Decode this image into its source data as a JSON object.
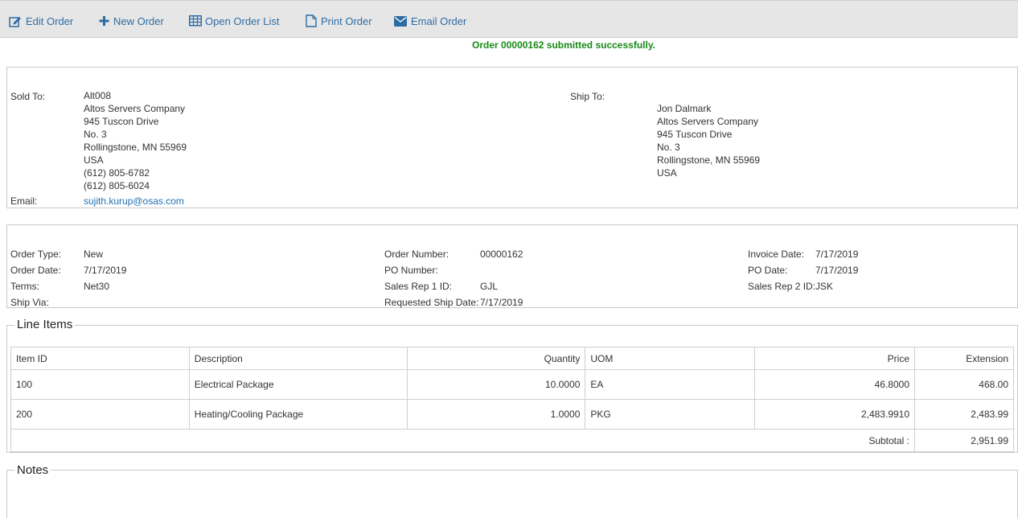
{
  "toolbar": {
    "items": [
      {
        "label": "Edit Order",
        "icon": "edit-icon"
      },
      {
        "label": "New Order",
        "icon": "plus-icon"
      },
      {
        "label": "Open Order List",
        "icon": "table-icon"
      },
      {
        "label": "Print Order",
        "icon": "document-icon"
      },
      {
        "label": "Email Order",
        "icon": "envelope-icon"
      }
    ]
  },
  "message": "Order 00000162 submitted successfully.",
  "sold_to": {
    "label": "Sold To:",
    "lines": [
      "Alt008",
      "Altos Servers Company",
      "945 Tuscon Drive",
      "No. 3",
      "Rollingstone, MN 55969",
      "USA",
      "(612) 805-6782",
      "(612) 805-6024"
    ],
    "email_label": "Email:",
    "email": "sujith.kurup@osas.com"
  },
  "ship_to": {
    "label": "Ship To:",
    "lines": [
      "Jon Dalmark",
      "Altos Servers Company",
      "945 Tuscon Drive",
      "No. 3",
      "Rollingstone, MN 55969",
      "USA"
    ]
  },
  "order_info": {
    "col1": [
      {
        "label": "Order Type:",
        "value": "New"
      },
      {
        "label": "Order Date:",
        "value": "7/17/2019"
      },
      {
        "label": "Terms:",
        "value": "Net30"
      },
      {
        "label": "Ship Via:",
        "value": ""
      }
    ],
    "col2": [
      {
        "label": "Order Number:",
        "value": "00000162"
      },
      {
        "label": "PO Number:",
        "value": ""
      },
      {
        "label": "Sales Rep 1 ID:",
        "value": "GJL"
      },
      {
        "label": "Requested Ship Date:",
        "value": "7/17/2019"
      }
    ],
    "col3": [
      {
        "label": "Invoice Date:",
        "value": "7/17/2019"
      },
      {
        "label": "PO Date:",
        "value": "7/17/2019"
      },
      {
        "label": "Sales Rep 2 ID:",
        "value": "JSK"
      }
    ]
  },
  "line_items": {
    "title": "Line Items",
    "headers": [
      "Item ID",
      "Description",
      "Quantity",
      "UOM",
      "Price",
      "Extension"
    ],
    "rows": [
      [
        "100",
        "Electrical Package",
        "10.0000",
        "EA",
        "46.8000",
        "468.00"
      ],
      [
        "200",
        "Heating/Cooling Package",
        "1.0000",
        "PKG",
        "2,483.9910",
        "2,483.99"
      ]
    ],
    "subtotal_label": "Subtotal :",
    "subtotal_value": "2,951.99"
  },
  "notes": {
    "title": "Notes"
  }
}
